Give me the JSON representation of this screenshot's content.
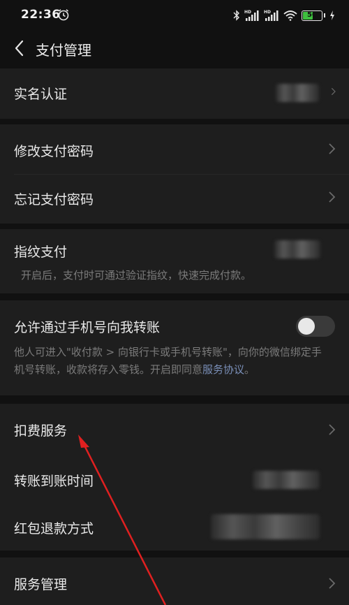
{
  "status_bar": {
    "time": "22:36",
    "battery": "50",
    "icons": [
      "alarm-icon",
      "bluetooth-icon",
      "hd-signal-icon",
      "hd-signal-icon",
      "wifi-icon",
      "battery-icon",
      "charging-icon"
    ]
  },
  "header": {
    "title": "支付管理",
    "back_icon": "back-chevron-icon"
  },
  "sections": {
    "realname": {
      "label": "实名认证"
    },
    "change_password": {
      "label": "修改支付密码"
    },
    "forgot_password": {
      "label": "忘记支付密码"
    },
    "fingerprint": {
      "label": "指纹支付",
      "desc": "开启后，支付时可通过验证指纹，快速完成付款。"
    },
    "phone_transfer": {
      "label": "允许通过手机号向我转账",
      "desc": "他人可进入\"收付款 > 向银行卡或手机号转账\"，向你的微信绑定手机号转账，收款将存入零钱。开启即同意",
      "link": "服务协议",
      "desc_end": "。",
      "enabled": false
    },
    "deduction": {
      "label": "扣费服务"
    },
    "arrival_time": {
      "label": "转账到账时间"
    },
    "refund": {
      "label": "红包退款方式"
    },
    "service_manage": {
      "label": "服务管理"
    }
  },
  "colors": {
    "background": "#111111",
    "card": "#1e1e1e",
    "link": "#7a8fb8",
    "annotation_arrow": "#e02020"
  }
}
